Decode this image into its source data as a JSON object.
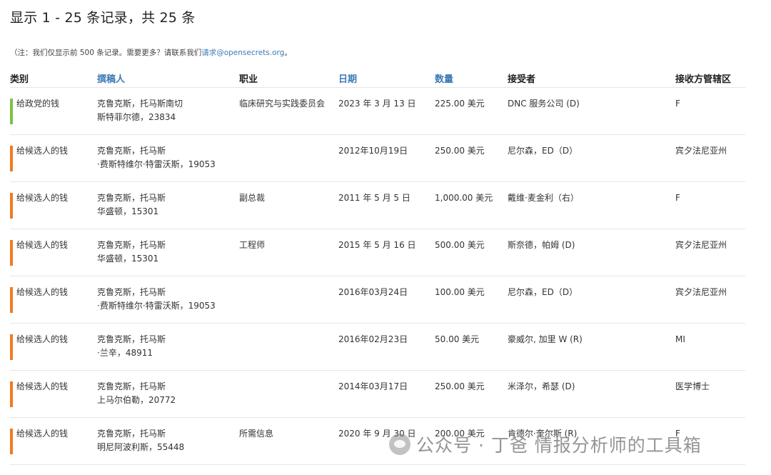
{
  "summary": "显示 1 - 25 条记录，共 25 条",
  "note": {
    "prefix": "（注：我们仅显示前 500 条记录。需要更多？请联系我们",
    "link_text": "请求",
    "email_suffix": "@opensecrets.org",
    "suffix": "。"
  },
  "headers": {
    "type": "类别",
    "contributor": "撰稿人",
    "occupation": "职业",
    "date": "日期",
    "amount": "数量",
    "recipient": "接受者",
    "state": "接收方管辖区"
  },
  "colors": {
    "party_bar": "#7dc242",
    "candidate_bar": "#f47a20",
    "link": "#3d7ab7"
  },
  "rows": [
    {
      "type": "给政党的钱",
      "bar": "party",
      "contrib_line1": "克鲁克斯，托马斯南切",
      "contrib_line2": "斯特菲尔德，23834",
      "occupation": "临床研究与实践委员会",
      "date": "2023 年 3 月 13 日",
      "amount": "225.00 美元",
      "recipient": "DNC 服务公司 (D)",
      "state": "F"
    },
    {
      "type": "给候选人的钱",
      "bar": "candidate",
      "contrib_line1": "克鲁克斯，托马斯",
      "contrib_line2": "·费斯特维尔·特雷沃斯，19053",
      "occupation": "",
      "date": "2012年10月19日",
      "amount": "250.00 美元",
      "recipient": "尼尔森，ED（D）",
      "state": "宾夕法尼亚州"
    },
    {
      "type": "给候选人的钱",
      "bar": "candidate",
      "contrib_line1": "克鲁克斯，托马斯",
      "contrib_line2": "华盛顿，15301",
      "occupation": "副总裁",
      "date": "2011 年 5 月 5 日",
      "amount": "1,000.00 美元",
      "recipient": "戴维·麦金利（右）",
      "state": "F"
    },
    {
      "type": "给候选人的钱",
      "bar": "candidate",
      "contrib_line1": "克鲁克斯，托马斯",
      "contrib_line2": "华盛顿，15301",
      "occupation": "工程师",
      "date": "2015 年 5 月 16 日",
      "amount": "500.00 美元",
      "recipient": "斯奈德，帕姆 (D)",
      "state": "宾夕法尼亚州"
    },
    {
      "type": "给候选人的钱",
      "bar": "candidate",
      "contrib_line1": "克鲁克斯，托马斯",
      "contrib_line2": "·费斯特维尔·特雷沃斯，19053",
      "occupation": "",
      "date": "2016年03月24日",
      "amount": "100.00 美元",
      "recipient": "尼尔森，ED（D）",
      "state": "宾夕法尼亚州"
    },
    {
      "type": "给候选人的钱",
      "bar": "candidate",
      "contrib_line1": "克鲁克斯，托马斯",
      "contrib_line2": "·兰辛，48911",
      "occupation": "",
      "date": "2016年02月23日",
      "amount": "50.00 美元",
      "recipient": "豪威尔, 加里 W (R)",
      "state": "MI"
    },
    {
      "type": "给候选人的钱",
      "bar": "candidate",
      "contrib_line1": "克鲁克斯，托马斯",
      "contrib_line2": "上马尔伯勒，20772",
      "occupation": "",
      "date": "2014年03月17日",
      "amount": "250.00 美元",
      "recipient": "米泽尔，希瑟 (D)",
      "state": "医学博士"
    },
    {
      "type": "给候选人的钱",
      "bar": "candidate",
      "contrib_line1": "克鲁克斯，托马斯",
      "contrib_line2": "明尼阿波利斯，55448",
      "occupation": "所需信息",
      "date": "2020 年 9 月 30 日",
      "amount": "200.00 美元",
      "recipient": "肯德尔·奎尔斯 (R)",
      "state": "F"
    }
  ],
  "watermark": "公众号 · 丁爸 情报分析师的工具箱"
}
